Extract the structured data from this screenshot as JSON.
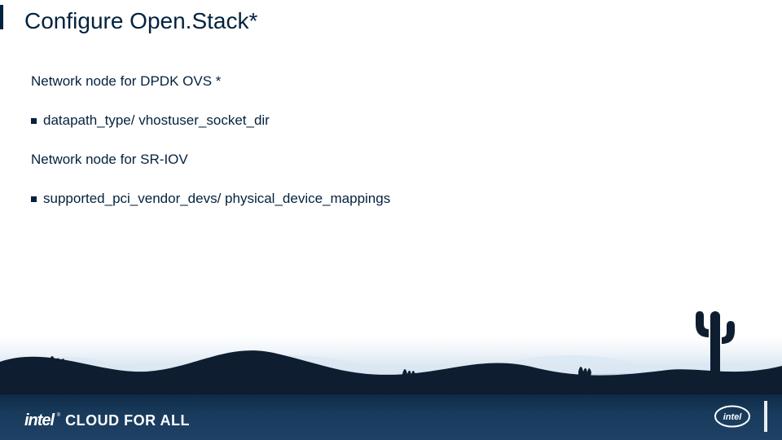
{
  "title": "Configure Open.Stack*",
  "sections": [
    {
      "type": "heading",
      "text": "Network node for DPDK OVS *"
    },
    {
      "type": "bullet",
      "text": "datapath_type/ vhostuser_socket_dir"
    },
    {
      "type": "heading",
      "text": "Network node for SR-IOV"
    },
    {
      "type": "bullet",
      "text": "supported_pci_vendor_devs/ physical_device_mappings"
    }
  ],
  "brand": {
    "intel": "intel",
    "reg": "®",
    "rest": "CLOUD FOR ALL"
  },
  "logo_alt": "intel"
}
